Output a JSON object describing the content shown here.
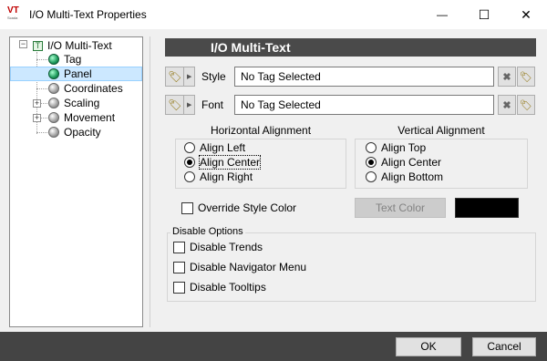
{
  "window": {
    "logo_text": "VT",
    "logo_sub": "Scada",
    "title": "I/O Multi-Text Properties",
    "minimize_glyph": "—",
    "maximize_glyph": "☐",
    "close_glyph": "✕"
  },
  "tree": {
    "root": "I/O Multi-Text",
    "items": [
      {
        "label": "Tag",
        "icon": "green-ball"
      },
      {
        "label": "Panel",
        "icon": "green-ball"
      },
      {
        "label": "Coordinates",
        "icon": "gray-ball"
      },
      {
        "label": "Scaling",
        "icon": "gray-ball"
      },
      {
        "label": "Movement",
        "icon": "gray-ball"
      },
      {
        "label": "Opacity",
        "icon": "gray-ball"
      }
    ],
    "expander": "+"
  },
  "panel": {
    "header": "I/O Multi-Text",
    "style_label": "Style",
    "style_value": "No Tag Selected",
    "font_label": "Font",
    "font_value": "No Tag Selected",
    "h_align_title": "Horizontal Alignment",
    "h_align_options": [
      "Align Left",
      "Align Center",
      "Align Right"
    ],
    "h_align_selected": "Align Center",
    "v_align_title": "Vertical Alignment",
    "v_align_options": [
      "Align Top",
      "Align Center",
      "Align Bottom"
    ],
    "v_align_selected": "Align Center",
    "override_label": "Override Style Color",
    "text_color_label": "Text Color",
    "text_color_value": "#000000",
    "disable_title": "Disable Options",
    "disable_options": [
      "Disable Trends",
      "Disable Navigator Menu",
      "Disable Tooltips"
    ]
  },
  "buttons": {
    "ok": "OK",
    "cancel": "Cancel"
  }
}
